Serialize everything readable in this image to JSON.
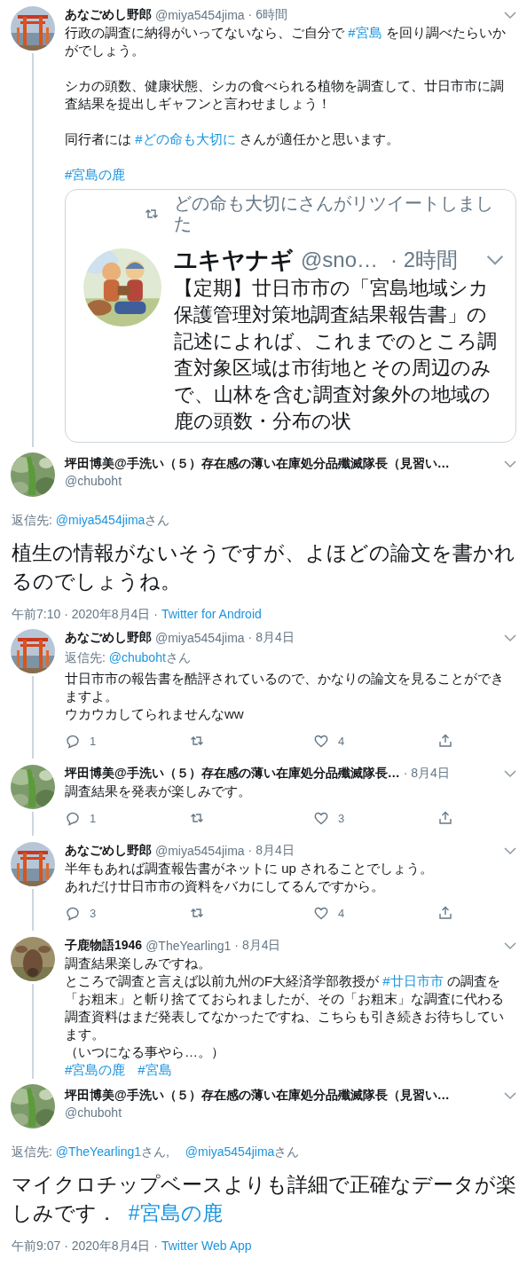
{
  "tweets": [
    {
      "kind": "thread",
      "name": "あなごめし野郎",
      "handle": "@miya5454jima",
      "time": "· 6時間",
      "thread_line": true,
      "paragraph_gap": true,
      "text": [
        [
          {
            "kind": "plain",
            "text": "行政の調査に納得がいってないなら、ご自分で "
          },
          {
            "kind": "hashtag",
            "text": "#宮島"
          },
          {
            "kind": "plain",
            "text": " を回り調べたらいかがでしょう。"
          }
        ],
        [
          {
            "kind": "plain",
            "text": "シカの頭数、健康状態、シカの食べられる植物を調査して、廿日市市に調査結果を提出しギャフンと言わせましょう！"
          }
        ],
        [
          {
            "kind": "plain",
            "text": "同行者には "
          },
          {
            "kind": "hashtag",
            "text": "#どの命も大切に"
          },
          {
            "kind": "plain",
            "text": " さんが適任かと思います。"
          }
        ],
        [
          {
            "kind": "hashtag",
            "text": "#宮島の鹿"
          }
        ]
      ],
      "quote": {
        "retweeted_by": "どの命も大切にさんがリツイートしました",
        "name": "ユキヤナギ",
        "handle": "@sno…",
        "time": "· 2時間",
        "text": "【定期】廿日市市の「宮島地域シカ保護管理対策地調査結果報告書」の記述によれば、これまでのところ調査対象区域は市街地とその周辺のみで、山林を含む調査対象外の地域の鹿の頭数・分布の状"
      }
    },
    {
      "kind": "focus",
      "name": "坪田博美@手洗い（５）存在感の薄い在庫処分品殲滅隊長（見習い…",
      "handle": "@chuboht",
      "reply_to": [
        {
          "kind": "plain",
          "text": "返信先: "
        },
        {
          "kind": "mention",
          "text": "@miya5454jima"
        },
        {
          "kind": "plain",
          "text": "さん"
        }
      ],
      "text": [
        [
          {
            "kind": "plain",
            "text": "植生の情報がないそうですが、よほどの論文を書かれるのでしょうね。"
          }
        ]
      ],
      "timestamp": "午前7:10 · 2020年8月4日 ·",
      "source": "Twitter for Android"
    },
    {
      "kind": "thread",
      "name": "あなごめし野郎",
      "handle": "@miya5454jima",
      "time": "· 8月4日",
      "thread_line": true,
      "reply_to": [
        {
          "kind": "plain",
          "text": "返信先: "
        },
        {
          "kind": "mention",
          "text": "@chuboht"
        },
        {
          "kind": "plain",
          "text": "さん"
        }
      ],
      "text": [
        [
          {
            "kind": "plain",
            "text": "廿日市市の報告書を酷評されているので、かなりの論文を見ることができますよ。"
          }
        ],
        [
          {
            "kind": "plain",
            "text": "ウカウカしてられませんなww"
          }
        ]
      ],
      "actions": {
        "replies": "1",
        "likes": "4"
      }
    },
    {
      "kind": "thread",
      "name": "坪田博美@手洗い（５）存在感の薄い在庫処分品殲滅隊長…",
      "time": "· 8月4日",
      "thread_line": true,
      "text": [
        [
          {
            "kind": "plain",
            "text": "調査結果を発表が楽しみです。"
          }
        ]
      ],
      "actions": {
        "replies": "1",
        "likes": "3"
      }
    },
    {
      "kind": "thread",
      "name": "あなごめし野郎",
      "handle": "@miya5454jima",
      "time": "· 8月4日",
      "thread_line": true,
      "text": [
        [
          {
            "kind": "plain",
            "text": "半年もあれば調査報告書がネットに up されることでしょう。"
          }
        ],
        [
          {
            "kind": "plain",
            "text": "あれだけ廿日市市の資料をバカにしてるんですから。"
          }
        ]
      ],
      "actions": {
        "replies": "3",
        "likes": "4"
      }
    },
    {
      "kind": "thread",
      "name": "子鹿物語1946",
      "handle": "@TheYearling1",
      "time": "· 8月4日",
      "thread_line": true,
      "text": [
        [
          {
            "kind": "plain",
            "text": "調査結果楽しみですね。"
          }
        ],
        [
          {
            "kind": "plain",
            "text": "ところで調査と言えば以前九州のF大経済学部教授が "
          },
          {
            "kind": "hashtag",
            "text": "#廿日市市"
          },
          {
            "kind": "plain",
            "text": " の調査を「お粗末」と斬り捨てておられましたが、その「お粗末」な調査に代わる調査資料はまだ発表してなかったですね、こちらも引き続きお待ちしています。"
          }
        ],
        [
          {
            "kind": "plain",
            "text": "（いつになる事やら…。）"
          }
        ],
        [
          {
            "kind": "hashtag",
            "text": "#宮島の鹿"
          },
          {
            "kind": "hashtag",
            "text": "#宮島"
          }
        ]
      ]
    },
    {
      "kind": "focus",
      "name": "坪田博美@手洗い（５）存在感の薄い在庫処分品殲滅隊長（見習い…",
      "handle": "@chuboht",
      "reply_to": [
        {
          "kind": "plain",
          "text": "返信先: "
        },
        {
          "kind": "mention",
          "text": "@TheYearling1"
        },
        {
          "kind": "plain",
          "text": "さん, "
        },
        {
          "kind": "mention",
          "text": "@miya5454jima"
        },
        {
          "kind": "plain",
          "text": "さん"
        }
      ],
      "text": [
        [
          {
            "kind": "plain",
            "text": "マイクロチップベースよりも詳細で正確なデータが楽しみです．  "
          },
          {
            "kind": "hashtag",
            "text": "#宮島の鹿"
          }
        ]
      ],
      "timestamp": "午前9:07 · 2020年8月4日 ·",
      "source": "Twitter Web App"
    }
  ]
}
